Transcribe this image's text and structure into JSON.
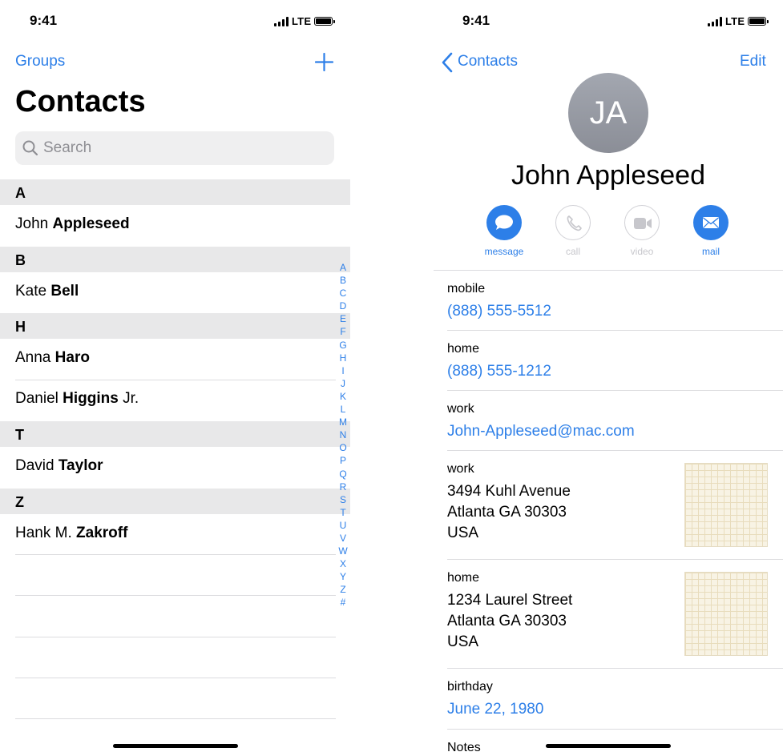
{
  "status": {
    "time": "9:41",
    "network": "LTE"
  },
  "list_screen": {
    "groups_label": "Groups",
    "add_label": "+",
    "title": "Contacts",
    "search_placeholder": "Search",
    "sections": [
      {
        "letter": "A",
        "contacts": [
          {
            "first": "John ",
            "last": "Appleseed",
            "suffix": ""
          }
        ]
      },
      {
        "letter": "B",
        "contacts": [
          {
            "first": "Kate ",
            "last": "Bell",
            "suffix": ""
          }
        ]
      },
      {
        "letter": "H",
        "contacts": [
          {
            "first": "Anna ",
            "last": "Haro",
            "suffix": ""
          },
          {
            "first": "Daniel ",
            "last": "Higgins",
            "suffix": " Jr."
          }
        ]
      },
      {
        "letter": "T",
        "contacts": [
          {
            "first": "David ",
            "last": "Taylor",
            "suffix": ""
          }
        ]
      },
      {
        "letter": "Z",
        "contacts": [
          {
            "first": "Hank M. ",
            "last": "Zakroff",
            "suffix": ""
          }
        ]
      }
    ],
    "index_letters": [
      "A",
      "B",
      "C",
      "D",
      "E",
      "F",
      "G",
      "H",
      "I",
      "J",
      "K",
      "L",
      "M",
      "N",
      "O",
      "P",
      "Q",
      "R",
      "S",
      "T",
      "U",
      "V",
      "W",
      "X",
      "Y",
      "Z",
      "#"
    ]
  },
  "detail_screen": {
    "back_label": "Contacts",
    "edit_label": "Edit",
    "initials": "JA",
    "name": "John Appleseed",
    "actions": [
      {
        "label": "message",
        "icon": "message-icon",
        "enabled": true
      },
      {
        "label": "call",
        "icon": "phone-icon",
        "enabled": false
      },
      {
        "label": "video",
        "icon": "video-icon",
        "enabled": false
      },
      {
        "label": "mail",
        "icon": "mail-icon",
        "enabled": true
      }
    ],
    "fields": {
      "mobile": {
        "label": "mobile",
        "value": "(888) 555-5512"
      },
      "home_phone": {
        "label": "home",
        "value": "(888) 555-1212"
      },
      "work_email": {
        "label": "work",
        "value": "John-Appleseed@mac.com"
      },
      "work_address": {
        "label": "work",
        "line1": "3494 Kuhl Avenue",
        "line2": "Atlanta GA 30303",
        "line3": "USA"
      },
      "home_address": {
        "label": "home",
        "line1": "1234 Laurel Street",
        "line2": "Atlanta GA 30303",
        "line3": "USA"
      },
      "birthday": {
        "label": "birthday",
        "value": "June 22, 1980"
      },
      "notes": {
        "label": "Notes"
      }
    }
  },
  "colors": {
    "accent": "#2d7fe8",
    "section_bg": "#e8e8e9",
    "disabled": "#c7c7cc"
  }
}
